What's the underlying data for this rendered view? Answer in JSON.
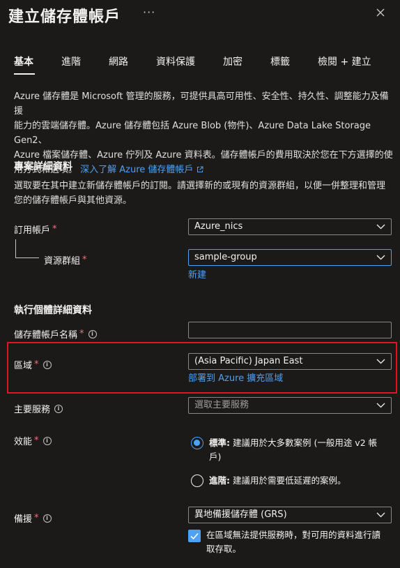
{
  "header": {
    "title": "建立儲存體帳戶",
    "more_label": "···"
  },
  "tabs": [
    "基本",
    "進階",
    "網路",
    "資料保護",
    "加密",
    "標籤",
    "檢閱 + 建立"
  ],
  "intro": {
    "line1": "Azure 儲存體是 Microsoft 管理的服務，可提供具高可用性、安全性、持久性、調整能力及備援",
    "line2": "能力的雲端儲存體。Azure 儲存體包括 Azure Blob (物件)、Azure Data Lake Storage Gen2、",
    "line3": "Azure 檔案儲存體、Azure 佇列及 Azure 資料表。儲存體帳戶的費用取決於您在下方選擇的使",
    "line4": "用方式和選項。",
    "link": "深入了解 Azure 儲存體帳戶"
  },
  "project": {
    "heading": "專案詳細資料",
    "desc1": "選取要在其中建立新儲存體帳戶的訂閱。請選擇新的或現有的資源群組，以便一併整理和管理",
    "desc2": "您的儲存體帳戶與其他資源。",
    "subscription_label": "訂用帳戶",
    "subscription_value": "Azure_nics",
    "resource_group_label": "資源群組",
    "resource_group_value": "sample-group",
    "create_new": "新建"
  },
  "instance": {
    "heading": "執行個體詳細資料",
    "name_label": "儲存體帳戶名稱",
    "name_value": "",
    "region_label": "區域",
    "region_value": "(Asia Pacific) Japan East",
    "region_link": "部署到 Azure 擴充區域",
    "primary_service_label": "主要服務",
    "primary_service_placeholder": "選取主要服務",
    "performance_label": "效能",
    "perf_standard_bold": "標準:",
    "perf_standard_text1": " 建議用於大多數案例 (一般用途 v2 帳",
    "perf_standard_text2": "戶)",
    "perf_premium_bold": "進階:",
    "perf_premium_text": " 建議用於需要低延遲的案例。",
    "redundancy_label": "備援",
    "redundancy_value": "異地備援儲存體 (GRS)",
    "read_access_text1": "在區域無法提供服務時，對可用的資料進行讀",
    "read_access_text2": "取存取。"
  },
  "required_mark": "*",
  "info_mark": "i",
  "colors": {
    "background": "#1b1a19",
    "accent": "#4ea1f3",
    "required": "#f1707b",
    "highlight": "#e81123"
  }
}
